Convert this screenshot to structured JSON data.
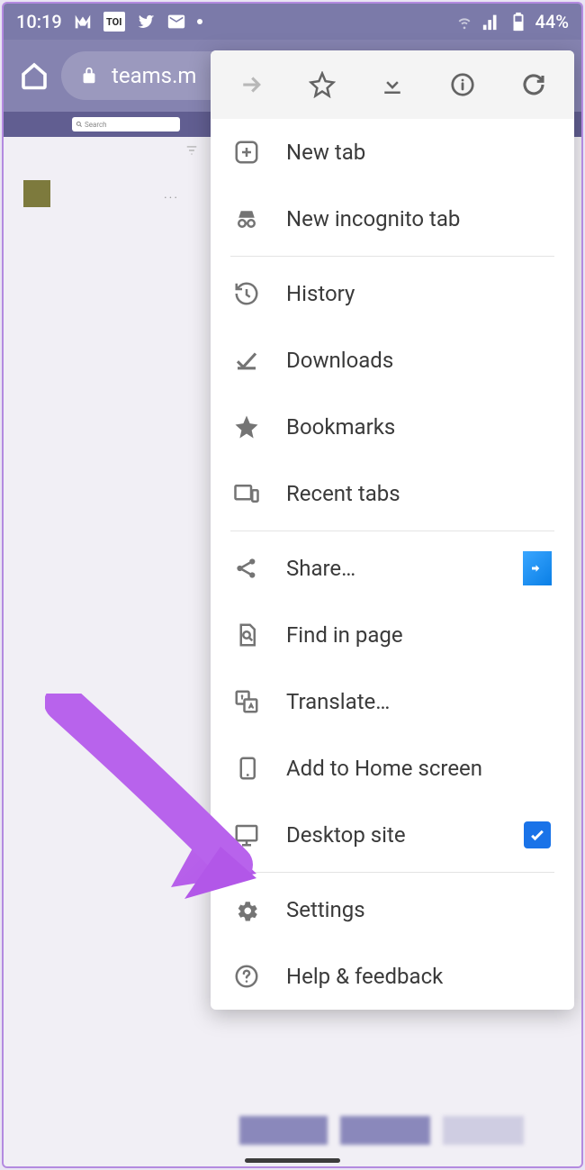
{
  "statusbar": {
    "time": "10:19",
    "battery": "44%",
    "toi_label": "TOI"
  },
  "toolbar": {
    "url": "teams.m"
  },
  "teams": {
    "search_placeholder": "Search"
  },
  "menu": {
    "new_tab": "New tab",
    "new_incognito": "New incognito tab",
    "history": "History",
    "downloads": "Downloads",
    "bookmarks": "Bookmarks",
    "recent_tabs": "Recent tabs",
    "share": "Share…",
    "find": "Find in page",
    "translate": "Translate…",
    "add_home": "Add to Home screen",
    "desktop_site": "Desktop site",
    "desktop_site_checked": true,
    "settings": "Settings",
    "help": "Help & feedback"
  }
}
